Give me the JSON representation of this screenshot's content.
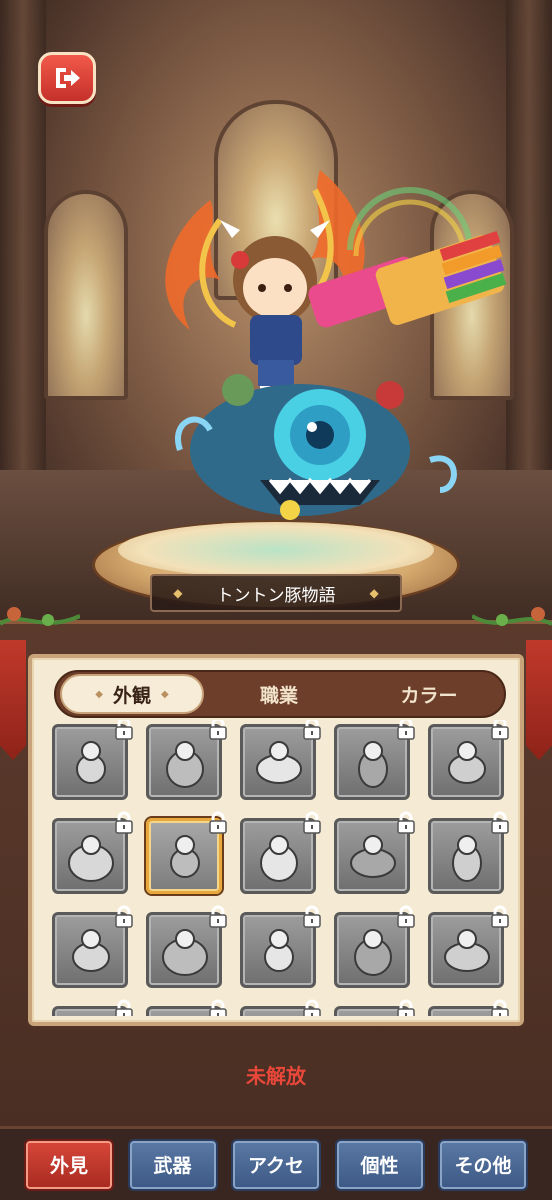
{
  "header": {
    "exit_icon": "exit-arrow-icon"
  },
  "character": {
    "name": "トントン豚物語"
  },
  "panel": {
    "tabs": [
      {
        "label": "外観",
        "active": true
      },
      {
        "label": "職業",
        "active": false
      },
      {
        "label": "カラー",
        "active": false
      }
    ],
    "items": [
      {
        "sprite": "dress",
        "locked": true,
        "selected": false
      },
      {
        "sprite": "robot-pile",
        "locked": true,
        "selected": false
      },
      {
        "sprite": "rock-creature",
        "locked": true,
        "selected": false
      },
      {
        "sprite": "hat-creature",
        "locked": true,
        "selected": false
      },
      {
        "sprite": "fat-beast",
        "locked": true,
        "selected": false
      },
      {
        "sprite": "helmet-creature",
        "locked": true,
        "selected": false
      },
      {
        "sprite": "bear-hat",
        "locked": true,
        "selected": true
      },
      {
        "sprite": "machine-pile",
        "locked": true,
        "selected": false
      },
      {
        "sprite": "boy",
        "locked": true,
        "selected": false
      },
      {
        "sprite": "girl",
        "locked": true,
        "selected": false
      },
      {
        "sprite": "cat-girl",
        "locked": true,
        "selected": false
      },
      {
        "sprite": "orc",
        "locked": true,
        "selected": false
      },
      {
        "sprite": "kid",
        "locked": true,
        "selected": false
      },
      {
        "sprite": "monster-group",
        "locked": true,
        "selected": false
      },
      {
        "sprite": "dark-queen",
        "locked": true,
        "selected": false
      },
      {
        "sprite": "partial-1",
        "locked": true,
        "selected": false
      },
      {
        "sprite": "partial-2",
        "locked": true,
        "selected": false
      },
      {
        "sprite": "partial-3",
        "locked": true,
        "selected": false
      },
      {
        "sprite": "partial-4",
        "locked": true,
        "selected": false
      },
      {
        "sprite": "partial-5",
        "locked": true,
        "selected": false
      }
    ],
    "status_text": "未解放"
  },
  "bottom_nav": [
    {
      "label": "外見",
      "active": true
    },
    {
      "label": "武器",
      "active": false
    },
    {
      "label": "アクセ",
      "active": false
    },
    {
      "label": "個性",
      "active": false
    },
    {
      "label": "その他",
      "active": false
    }
  ],
  "colors": {
    "accent_red": "#d8473a",
    "nav_blue": "#4a6794",
    "status_red": "#e8473a",
    "locked_gray": "#8a8a8a"
  }
}
